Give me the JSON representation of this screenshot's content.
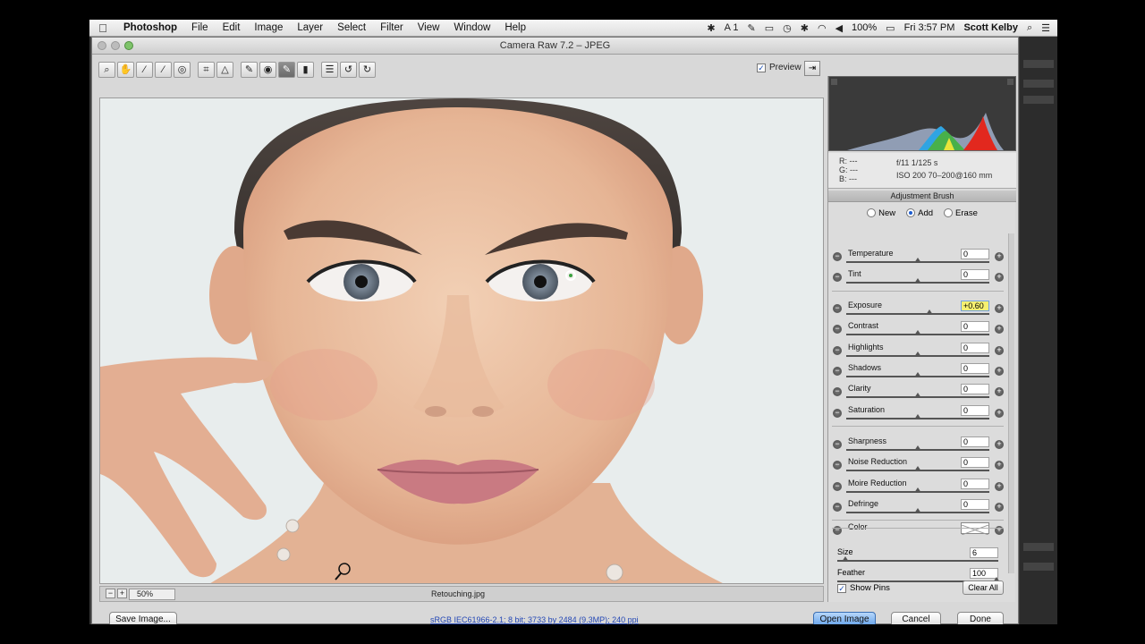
{
  "menubar": {
    "app": "Photoshop",
    "items": [
      "File",
      "Edit",
      "Image",
      "Layer",
      "Select",
      "Filter",
      "View",
      "Window",
      "Help"
    ],
    "status": {
      "battery": "100%",
      "clock": "Fri 3:57 PM",
      "user": "Scott Kelby",
      "adobe_count": "1"
    }
  },
  "dialog": {
    "title": "Camera Raw 7.2  –  JPEG",
    "preview_label": "Preview",
    "zoom": "50%",
    "filename": "Retouching.jpg",
    "workflow": "sRGB IEC61966-2.1; 8 bit; 3733 by 2484 (9.3MP); 240 ppi",
    "buttons": {
      "save": "Save Image...",
      "open": "Open Image",
      "cancel": "Cancel",
      "done": "Done"
    }
  },
  "info": {
    "r": "R:  ---",
    "g": "G:  ---",
    "b": "B:  ---",
    "aperture_shutter": "f/11    1/125 s",
    "iso_lens": "ISO 200    70–200@160 mm"
  },
  "panel": {
    "title": "Adjustment Brush",
    "modes": [
      "New",
      "Add",
      "Erase"
    ],
    "group1": [
      {
        "label": "Temperature",
        "value": "0",
        "pos": 0.5
      },
      {
        "label": "Tint",
        "value": "0",
        "pos": 0.5
      }
    ],
    "group2": [
      {
        "label": "Exposure",
        "value": "+0.60",
        "pos": 0.58,
        "highlight": true
      },
      {
        "label": "Contrast",
        "value": "0",
        "pos": 0.5
      },
      {
        "label": "Highlights",
        "value": "0",
        "pos": 0.5
      },
      {
        "label": "Shadows",
        "value": "0",
        "pos": 0.5
      },
      {
        "label": "Clarity",
        "value": "0",
        "pos": 0.5
      },
      {
        "label": "Saturation",
        "value": "0",
        "pos": 0.5
      }
    ],
    "group3": [
      {
        "label": "Sharpness",
        "value": "0",
        "pos": 0.5
      },
      {
        "label": "Noise Reduction",
        "value": "0",
        "pos": 0.5
      },
      {
        "label": "Moire Reduction",
        "value": "0",
        "pos": 0.5
      },
      {
        "label": "Defringe",
        "value": "0",
        "pos": 0.5
      }
    ],
    "color_label": "Color",
    "size": {
      "label": "Size",
      "value": "6",
      "pos": 0.05
    },
    "feather": {
      "label": "Feather",
      "value": "100",
      "pos": 1.0
    },
    "show_pins": "Show Pins",
    "clear_all": "Clear All"
  },
  "colors": {
    "accent": "#5f9ee8",
    "highlight_field": "#f5f071"
  }
}
